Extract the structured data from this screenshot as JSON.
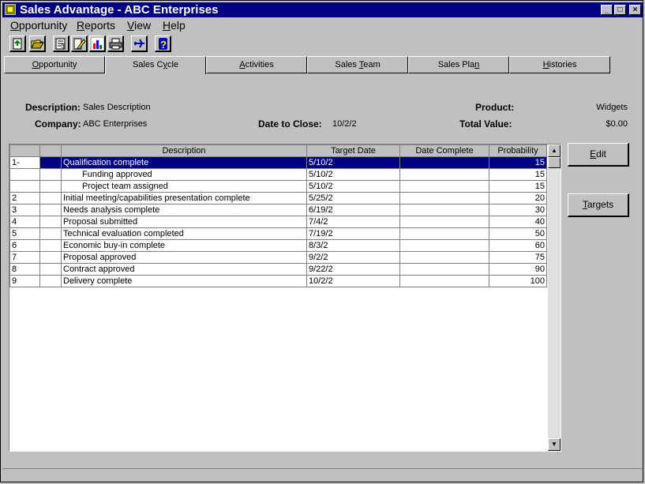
{
  "window": {
    "title": "Sales Advantage - ABC Enterprises",
    "controls": {
      "minimize": "_",
      "maximize": "□",
      "close": "×"
    }
  },
  "menu": [
    {
      "label": "Opportunity",
      "accel": "O",
      "rest": "pportunity"
    },
    {
      "label": "Reports",
      "accel": "R",
      "rest": "eports"
    },
    {
      "label": "View",
      "accel": "V",
      "rest": "iew"
    },
    {
      "label": "Help",
      "accel": "H",
      "rest": "elp"
    }
  ],
  "toolbar": {
    "icons": [
      "new-icon",
      "open-folder-icon",
      "report-icon",
      "edit-pencil-icon",
      "chart-icon",
      "print-icon",
      "airplane-icon",
      "help-icon"
    ]
  },
  "tabs": [
    {
      "label": "Opportunity",
      "accel": "O",
      "rest": "pportunity"
    },
    {
      "label": "Sales Cycle",
      "prefix": "Sales C",
      "accel": "y",
      "rest": "cle"
    },
    {
      "label": "Activities",
      "accel": "A",
      "rest": "ctivities"
    },
    {
      "label": "Sales Team",
      "prefix": "Sales ",
      "accel": "T",
      "rest": "eam"
    },
    {
      "label": "Sales Plan",
      "prefix": "Sales Pla",
      "accel": "n",
      "rest": ""
    },
    {
      "label": "Histories",
      "accel": "H",
      "rest": "istories"
    }
  ],
  "form": {
    "description_label": "Description:",
    "description_value": "Sales Description",
    "company_label": "Company:",
    "company_value": "ABC Enterprises",
    "date_to_close_label": "Date to Close:",
    "date_to_close_value": "10/2/2",
    "product_label": "Product:",
    "product_value": "Widgets",
    "total_value_label": "Total Value:",
    "total_value_value": "$0.00"
  },
  "grid": {
    "columns": [
      "",
      "",
      "Description",
      "Target Date",
      "Date Complete",
      "Probability"
    ],
    "rows": [
      {
        "num": "1-",
        "desc": "Qualification complete",
        "target": "5/10/2",
        "complete": "",
        "prob": "15",
        "indent": false,
        "selected": true
      },
      {
        "num": "",
        "desc": "Funding approved",
        "target": "5/10/2",
        "complete": "",
        "prob": "15",
        "indent": true,
        "selected": false
      },
      {
        "num": "",
        "desc": "Project team assigned",
        "target": "5/10/2",
        "complete": "",
        "prob": "15",
        "indent": true,
        "selected": false
      },
      {
        "num": "2",
        "desc": "Initial meeting/capabilities presentation complete",
        "target": "5/25/2",
        "complete": "",
        "prob": "20",
        "indent": false,
        "selected": false
      },
      {
        "num": "3",
        "desc": "Needs analysis complete",
        "target": "6/19/2",
        "complete": "",
        "prob": "30",
        "indent": false,
        "selected": false
      },
      {
        "num": "4",
        "desc": "Proposal submitted",
        "target": "7/4/2",
        "complete": "",
        "prob": "40",
        "indent": false,
        "selected": false
      },
      {
        "num": "5",
        "desc": "Technical evaluation completed",
        "target": "7/19/2",
        "complete": "",
        "prob": "50",
        "indent": false,
        "selected": false
      },
      {
        "num": "6",
        "desc": "Economic buy-in complete",
        "target": "8/3/2",
        "complete": "",
        "prob": "60",
        "indent": false,
        "selected": false
      },
      {
        "num": "7",
        "desc": "Proposal approved",
        "target": "9/2/2",
        "complete": "",
        "prob": "75",
        "indent": false,
        "selected": false
      },
      {
        "num": "8",
        "desc": "Contract approved",
        "target": "9/22/2",
        "complete": "",
        "prob": "90",
        "indent": false,
        "selected": false
      },
      {
        "num": "9",
        "desc": "Delivery complete",
        "target": "10/2/2",
        "complete": "",
        "prob": "100",
        "indent": false,
        "selected": false
      }
    ]
  },
  "buttons": {
    "edit": {
      "accel": "E",
      "rest": "dit"
    },
    "targets": {
      "accel": "T",
      "rest": "argets"
    }
  },
  "colors": {
    "titlebar": "#000080",
    "selection": "#000080",
    "face": "#c0c0c0"
  }
}
